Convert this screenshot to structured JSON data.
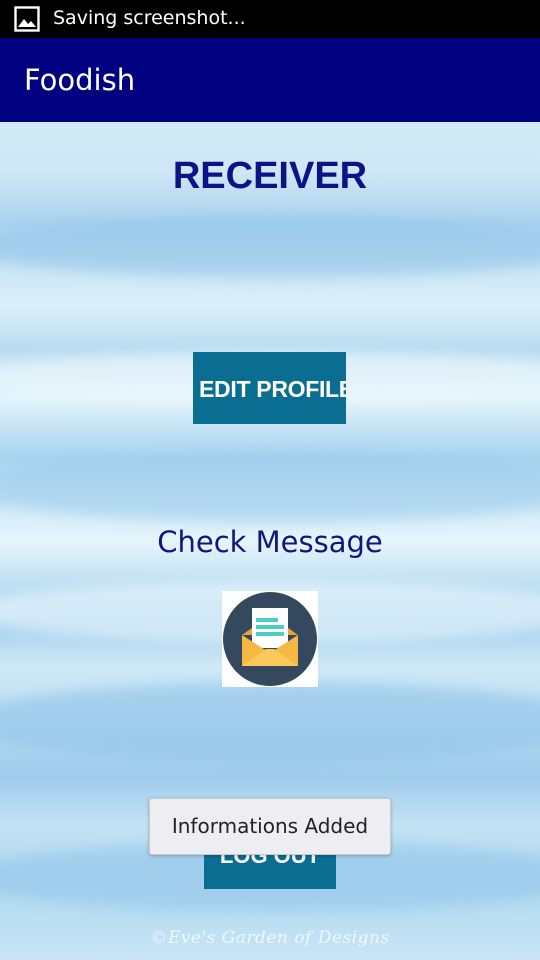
{
  "status_bar": {
    "text": "Saving screenshot...",
    "icon": "image-icon"
  },
  "app_bar": {
    "title": "Foodish",
    "color": "#000080"
  },
  "main": {
    "heading": "RECEIVER",
    "edit_profile_label": "EDIT PROFILE",
    "check_message_label": "Check Message",
    "message_icon": "envelope-letter-icon",
    "logout_label": "LOG OUT",
    "button_color": "#0a6e93",
    "watermark": "©Eve's Garden of Designs"
  },
  "toast": {
    "text": "Informations Added"
  }
}
